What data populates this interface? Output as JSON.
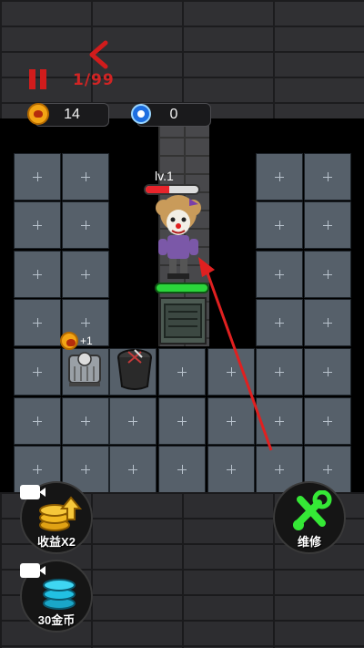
{
  "hud": {
    "level_progress": "1/99",
    "coins": "14",
    "gems": "0"
  },
  "player": {
    "level_label": "lv.1",
    "hp_fraction": 0.45
  },
  "door": {
    "hp_fraction": 1.0
  },
  "bed_bonus": {
    "label": "+1"
  },
  "buttons": {
    "income_label": "收益X2",
    "coins_label": "30金币",
    "repair_label": "维修"
  },
  "colors": {
    "hp_red": "#e7242b",
    "door_green": "#2bd63b",
    "pause_red": "#d11c1c",
    "coin_gold": "#f3a515",
    "gem_blue": "#1d6ee0",
    "repair_green": "#35e836",
    "arrow_red": "#e02020"
  }
}
